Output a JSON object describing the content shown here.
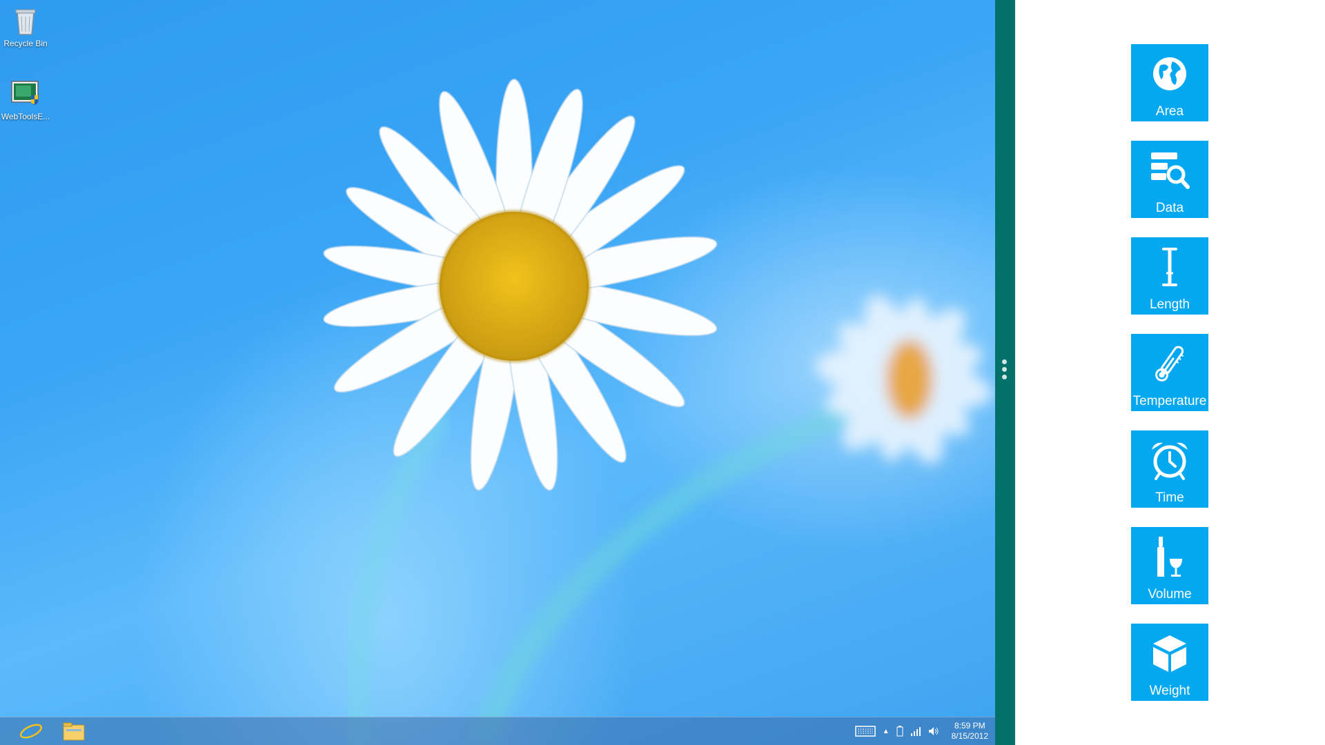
{
  "desktop": {
    "icons": [
      {
        "label": "Recycle Bin",
        "icon": "recycle-bin-icon"
      },
      {
        "label": "WebToolsE...",
        "icon": "setup-shield-icon"
      }
    ]
  },
  "taskbar": {
    "pinned": [
      {
        "name": "Internet Explorer",
        "icon": "internet-explorer-icon"
      },
      {
        "name": "File Explorer",
        "icon": "folder-icon"
      }
    ],
    "tray": {
      "icons": [
        "keyboard-icon",
        "show-hidden-icons-arrow",
        "battery-icon",
        "network-signal-icon",
        "volume-icon"
      ],
      "time": "8:59 PM",
      "date": "8/15/2012"
    }
  },
  "app": {
    "tiles": [
      {
        "label": "Area",
        "icon": "globe-icon"
      },
      {
        "label": "Data",
        "icon": "data-search-icon"
      },
      {
        "label": "Length",
        "icon": "ibeam-length-icon"
      },
      {
        "label": "Temperature",
        "icon": "thermometer-icon"
      },
      {
        "label": "Time",
        "icon": "alarm-clock-icon"
      },
      {
        "label": "Volume",
        "icon": "bottle-glass-icon"
      },
      {
        "label": "Weight",
        "icon": "cube-icon"
      }
    ],
    "tile_color": "#03a8f0",
    "splitter_color": "#03706a"
  }
}
